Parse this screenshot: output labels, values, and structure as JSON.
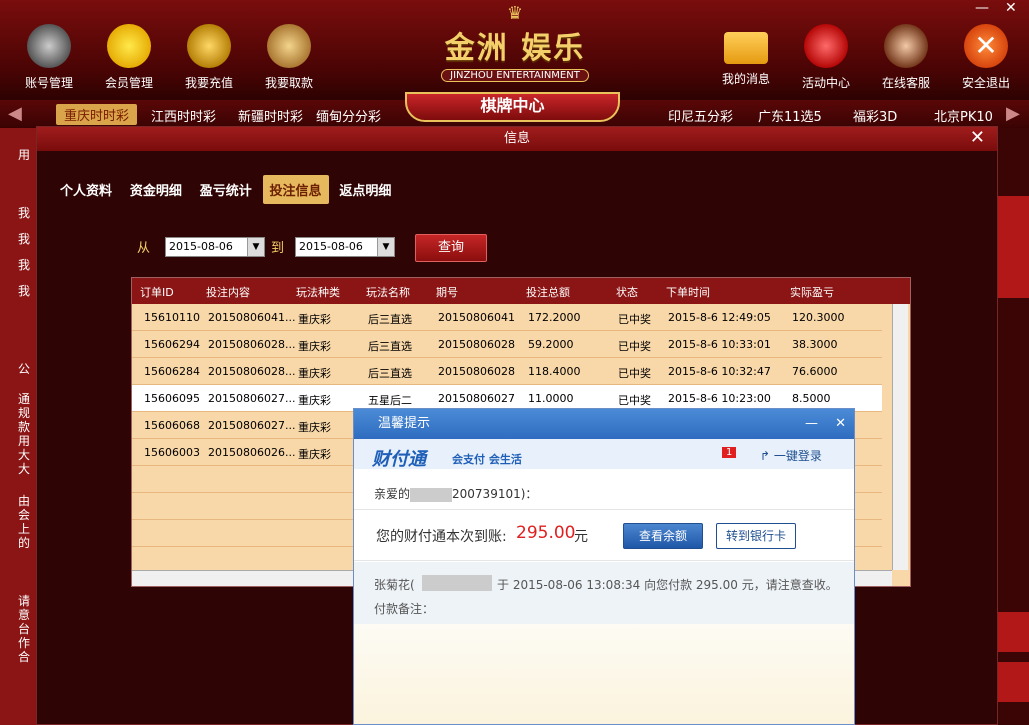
{
  "nav_left": [
    {
      "label": "账号管理",
      "icon": "account-icon"
    },
    {
      "label": "会员管理",
      "icon": "smiley-icon"
    },
    {
      "label": "我要充值",
      "icon": "coins-icon"
    },
    {
      "label": "我要取款",
      "icon": "money-bag-icon"
    }
  ],
  "nav_right": [
    {
      "label": "我的消息",
      "icon": "envelope-icon"
    },
    {
      "label": "活动中心",
      "icon": "ruby-icon"
    },
    {
      "label": "在线客服",
      "icon": "support-agent-icon"
    },
    {
      "label": "安全退出",
      "icon": "exit-icon"
    }
  ],
  "logo": {
    "name": "金洲 娱乐",
    "en": "JINZHOU ENTERTAINMENT",
    "center_tab": "棋牌中心"
  },
  "lotteries_left": [
    "重庆时时彩",
    "江西时时彩",
    "新疆时时彩",
    "缅甸分分彩"
  ],
  "lotteries_right": [
    "印尼五分彩",
    "广东11选5",
    "福彩3D",
    "北京PK10"
  ],
  "left_panel": {
    "items": [
      "用",
      "我",
      "我",
      "我",
      "我",
      "公",
      "通",
      "规",
      "款",
      "用",
      "大",
      "大",
      "由",
      "会",
      "上",
      "的",
      "请",
      "意",
      "台",
      "作",
      "合"
    ]
  },
  "modal": {
    "title": "信息",
    "tabs": [
      "个人资料",
      "资金明细",
      "盈亏统计",
      "投注信息",
      "返点明细"
    ],
    "active_tab": "投注信息",
    "from_label": "从",
    "to_label": "到",
    "from_date": "2015-08-06",
    "to_date": "2015-08-06",
    "query_label": "查询",
    "columns": [
      "订单ID",
      "投注内容",
      "玩法种类",
      "玩法名称",
      "期号",
      "投注总额",
      "状态",
      "下单时间",
      "实际盈亏"
    ],
    "rows": [
      [
        "15610110",
        "20150806041...",
        "重庆彩",
        "后三直选",
        "20150806041",
        "172.2000",
        "已中奖",
        "2015-8-6 12:49:05",
        "120.3000"
      ],
      [
        "15606294",
        "20150806028...",
        "重庆彩",
        "后三直选",
        "20150806028",
        "59.2000",
        "已中奖",
        "2015-8-6 10:33:01",
        "38.3000"
      ],
      [
        "15606284",
        "20150806028...",
        "重庆彩",
        "后三直选",
        "20150806028",
        "118.4000",
        "已中奖",
        "2015-8-6 10:32:47",
        "76.6000"
      ],
      [
        "15606095",
        "20150806027...",
        "重庆彩",
        "五星后二",
        "20150806027",
        "11.0000",
        "已中奖",
        "2015-8-6 10:23:00",
        "8.5000"
      ],
      [
        "15606068",
        "20150806027...",
        "重庆彩",
        "",
        "",
        "",
        "",
        "",
        ""
      ],
      [
        "15606003",
        "20150806026...",
        "重庆彩",
        "",
        "",
        "",
        "",
        "",
        ""
      ]
    ]
  },
  "popup": {
    "title": "温馨提示",
    "brand": "财付通",
    "brand_slogan": "会支付 会生活",
    "badge": "1",
    "login": "一键登录",
    "greeting_prefix": "亲爱的",
    "greeting_suffix": "200739101)：",
    "notice_prefix": "您的财付通本次到账:",
    "amount": "295.00",
    "unit": "元",
    "btn_balance": "查看余额",
    "btn_bank": "转到银行卡",
    "payer_name": "张菊花(",
    "payer_msg": "于 2015-08-06 13:08:34 向您付款 295.00 元，请注意查收。",
    "remark_label": "付款备注："
  },
  "colors": {
    "accent": "#8b1414",
    "gold": "#e9c25b",
    "amount_red": "#e02020",
    "popup_blue": "#2f6cc0"
  }
}
